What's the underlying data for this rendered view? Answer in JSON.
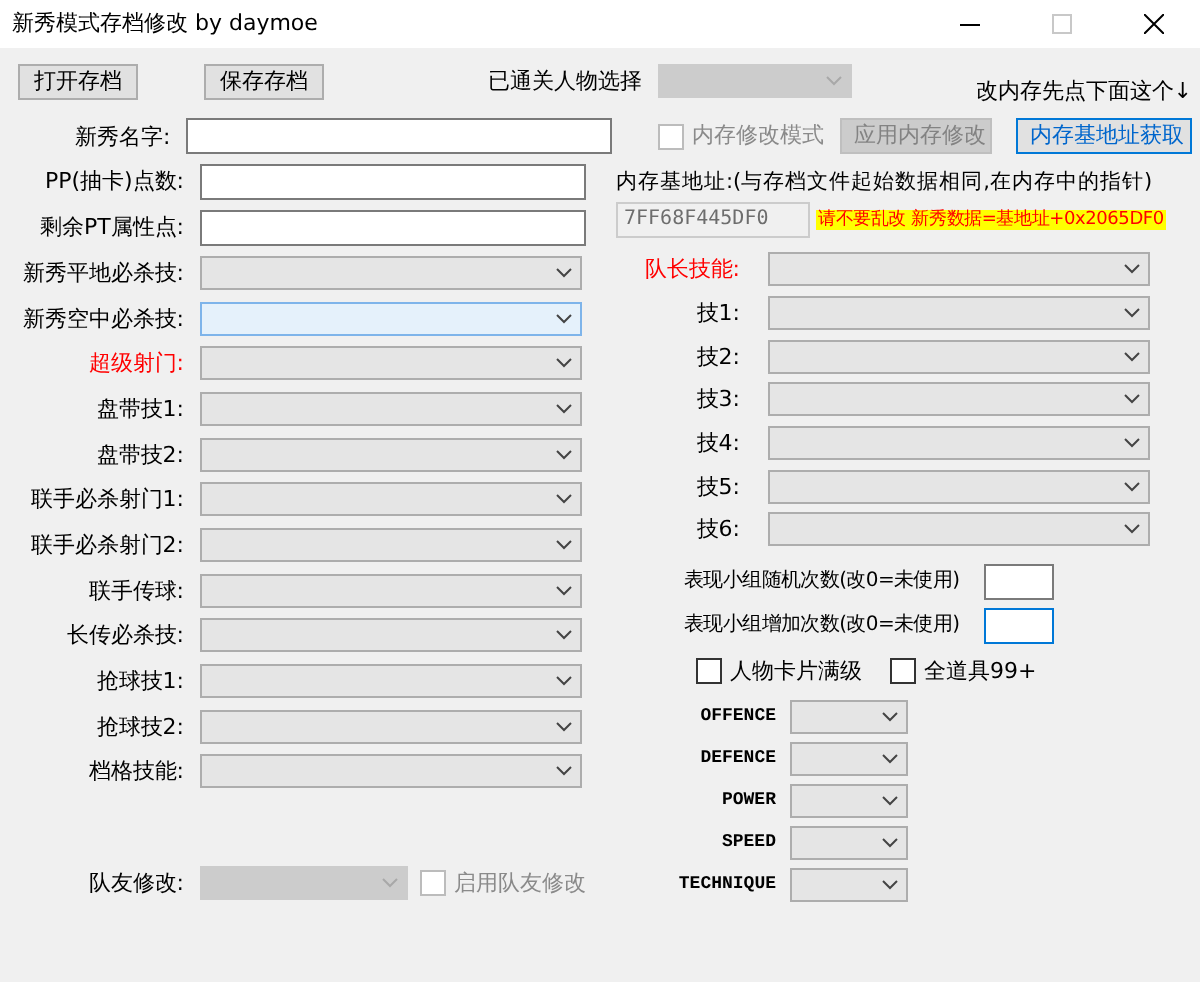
{
  "window": {
    "title": "新秀模式存档修改 by  daymoe"
  },
  "toolbar": {
    "buttons": [
      {
        "label": "打开存档"
      },
      {
        "label": "保存存档"
      }
    ],
    "character_select": {
      "label": "已通关人物选择",
      "disabled": true
    },
    "hint": "改内存先点下面这个↓"
  },
  "left_fields": [
    {
      "kind": "text",
      "label": "新秀名字:",
      "emphasis": false,
      "focused": false,
      "wide": true
    },
    {
      "kind": "text",
      "label": "PP(抽卡)点数:",
      "emphasis": false,
      "focused": false,
      "wide": false
    },
    {
      "kind": "text",
      "label": "剩余PT属性点:",
      "emphasis": false,
      "focused": false,
      "wide": false
    },
    {
      "kind": "combo",
      "label": "新秀平地必杀技:",
      "emphasis": false,
      "focused": false
    },
    {
      "kind": "combo",
      "label": "新秀空中必杀技:",
      "emphasis": false,
      "focused": true
    },
    {
      "kind": "combo",
      "label": "超级射门:",
      "emphasis": true,
      "focused": false
    },
    {
      "kind": "combo",
      "label": "盘带技1:",
      "emphasis": false,
      "focused": false
    },
    {
      "kind": "combo",
      "label": "盘带技2:",
      "emphasis": false,
      "focused": false
    },
    {
      "kind": "combo",
      "label": "联手必杀射门1:",
      "emphasis": false,
      "focused": false
    },
    {
      "kind": "combo",
      "label": "联手必杀射门2:",
      "emphasis": false,
      "focused": false
    },
    {
      "kind": "combo",
      "label": "联手传球:",
      "emphasis": false,
      "focused": false
    },
    {
      "kind": "combo",
      "label": "长传必杀技:",
      "emphasis": false,
      "focused": false
    },
    {
      "kind": "combo",
      "label": "抢球技1:",
      "emphasis": false,
      "focused": false
    },
    {
      "kind": "combo",
      "label": "抢球技2:",
      "emphasis": false,
      "focused": false
    },
    {
      "kind": "combo",
      "label": "档格技能:",
      "emphasis": false,
      "focused": false
    }
  ],
  "teammate": {
    "label": "队友修改:",
    "disabled": true,
    "checkbox": {
      "label": "启用队友修改",
      "checked": false,
      "disabled": true
    }
  },
  "memory": {
    "mode_checkbox": {
      "label": "内存修改模式",
      "checked": false,
      "disabled": true
    },
    "buttons": [
      {
        "label": "应用内存修改",
        "disabled": true,
        "focused": false
      },
      {
        "label": "内存基地址获取",
        "disabled": false,
        "focused": true
      }
    ],
    "base_label": "内存基地址:(与存档文件起始数据相同,在内存中的指针)",
    "address": "7FF68F445DF0",
    "warning": "请不要乱改 新秀数据=基地址+0x2065DF0"
  },
  "captain_skills": [
    {
      "label": "队长技能:",
      "emphasis": true
    },
    {
      "label": "技1:",
      "emphasis": false
    },
    {
      "label": "技2:",
      "emphasis": false
    },
    {
      "label": "技3:",
      "emphasis": false
    },
    {
      "label": "技4:",
      "emphasis": false
    },
    {
      "label": "技5:",
      "emphasis": false
    },
    {
      "label": "技6:",
      "emphasis": false
    }
  ],
  "counters": [
    {
      "label": "表现小组随机次数(改0=未使用)",
      "focused": false
    },
    {
      "label": "表现小组增加次数(改0=未使用)",
      "focused": true
    }
  ],
  "options": [
    {
      "label": "人物卡片满级",
      "checked": false
    },
    {
      "label": "全道具99+",
      "checked": false
    }
  ],
  "stats": [
    {
      "label": "OFFENCE"
    },
    {
      "label": "DEFENCE"
    },
    {
      "label": "POWER"
    },
    {
      "label": "SPEED"
    },
    {
      "label": "TECHNIQUE"
    }
  ]
}
